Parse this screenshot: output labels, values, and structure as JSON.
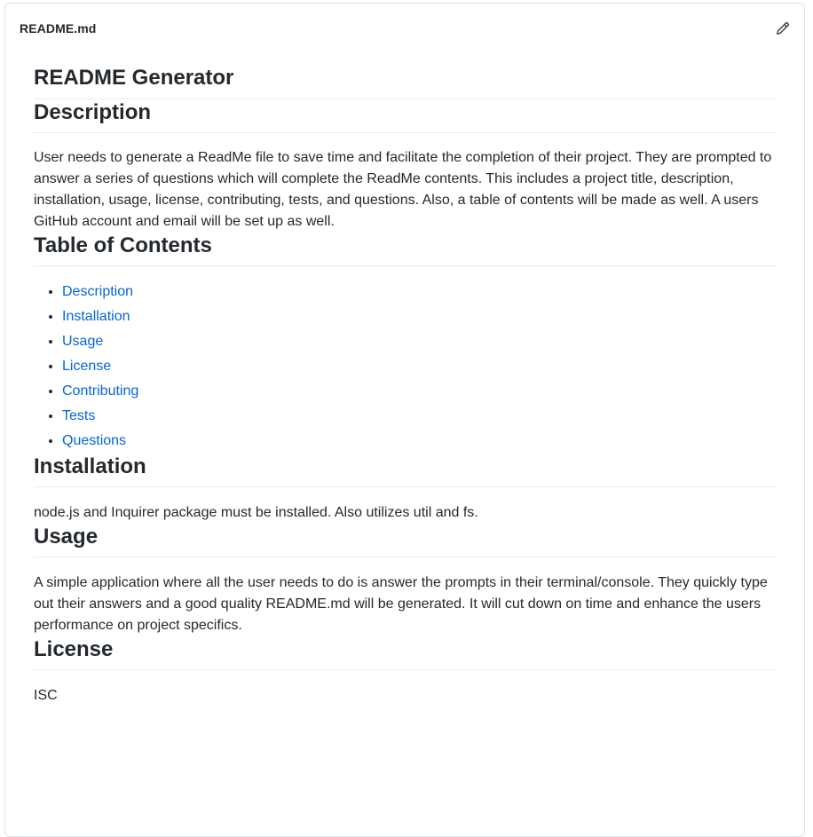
{
  "header": {
    "file_name": "README.md",
    "edit_icon": "pencil-icon"
  },
  "readme": {
    "title": "README Generator",
    "description": {
      "heading": "Description",
      "text": "User needs to generate a ReadMe file to save time and facilitate the completion of their project. They are prompted to answer a series of questions which will complete the ReadMe contents. This includes a project title, description, installation, usage, license, contributing, tests, and questions. Also, a table of contents will be made as well. A users GitHub account and email will be set up as well."
    },
    "toc": {
      "heading": "Table of Contents",
      "items": [
        {
          "label": "Description"
        },
        {
          "label": "Installation"
        },
        {
          "label": "Usage"
        },
        {
          "label": "License"
        },
        {
          "label": "Contributing"
        },
        {
          "label": "Tests"
        },
        {
          "label": "Questions"
        }
      ]
    },
    "installation": {
      "heading": "Installation",
      "text": "node.js and Inquirer package must be installed. Also utilizes util and fs."
    },
    "usage": {
      "heading": "Usage",
      "text": "A simple application where all the user needs to do is answer the prompts in their terminal/console. They quickly type out their answers and a good quality README.md will be generated. It will cut down on time and enhance the users performance on project specifics."
    },
    "license": {
      "heading": "License",
      "text": "ISC"
    }
  },
  "colors": {
    "link": "#0366d6",
    "text": "#24292e",
    "border": "#e1e4e8"
  }
}
